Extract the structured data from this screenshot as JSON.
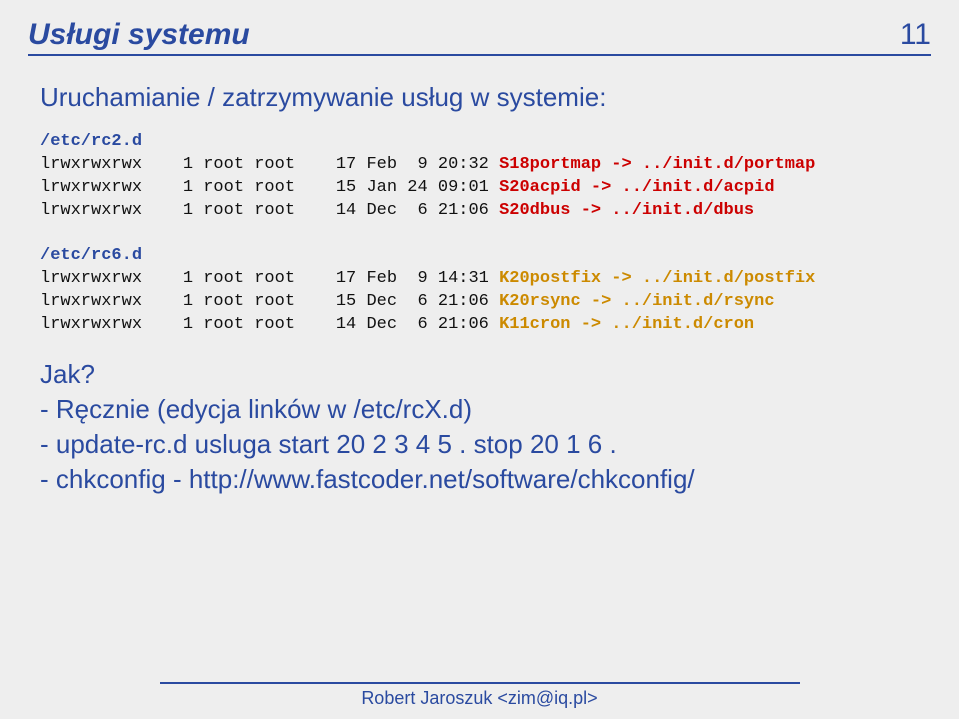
{
  "slide": {
    "title": "Usługi systemu",
    "page_number": "11",
    "heading": "Uruchamianie / zatrzymywanie usług w systemie:",
    "footer": "Robert Jaroszuk <zim@iq.pl>"
  },
  "block1": {
    "path": "/etc/rc2.d",
    "lines": [
      {
        "pre": "lrwxrwxrwx    1 root root    17 Feb  9 20:32 ",
        "svc": "S18portmap -> ../init.d/portmap",
        "cls": "s"
      },
      {
        "pre": "lrwxrwxrwx    1 root root    15 Jan 24 09:01 ",
        "svc": "S20acpid -> ../init.d/acpid",
        "cls": "s"
      },
      {
        "pre": "lrwxrwxrwx    1 root root    14 Dec  6 21:06 ",
        "svc": "S20dbus -> ../init.d/dbus",
        "cls": "s"
      }
    ]
  },
  "block2": {
    "path": "/etc/rc6.d",
    "lines": [
      {
        "pre": "lrwxrwxrwx    1 root root    17 Feb  9 14:31 ",
        "svc": "K20postfix -> ../init.d/postfix",
        "cls": "k"
      },
      {
        "pre": "lrwxrwxrwx    1 root root    15 Dec  6 21:06 ",
        "svc": "K20rsync -> ../init.d/rsync",
        "cls": "k"
      },
      {
        "pre": "lrwxrwxrwx    1 root root    14 Dec  6 21:06 ",
        "svc": "K11cron -> ../init.d/cron",
        "cls": "k"
      }
    ]
  },
  "list": {
    "q": "Jak?",
    "l1": "- Ręcznie (edycja linków w /etc/rcX.d)",
    "l2": "- update-rc.d usluga start 20 2 3 4 5 . stop 20 1 6 .",
    "l3": "- chkconfig - http://www.fastcoder.net/software/chkconfig/"
  }
}
